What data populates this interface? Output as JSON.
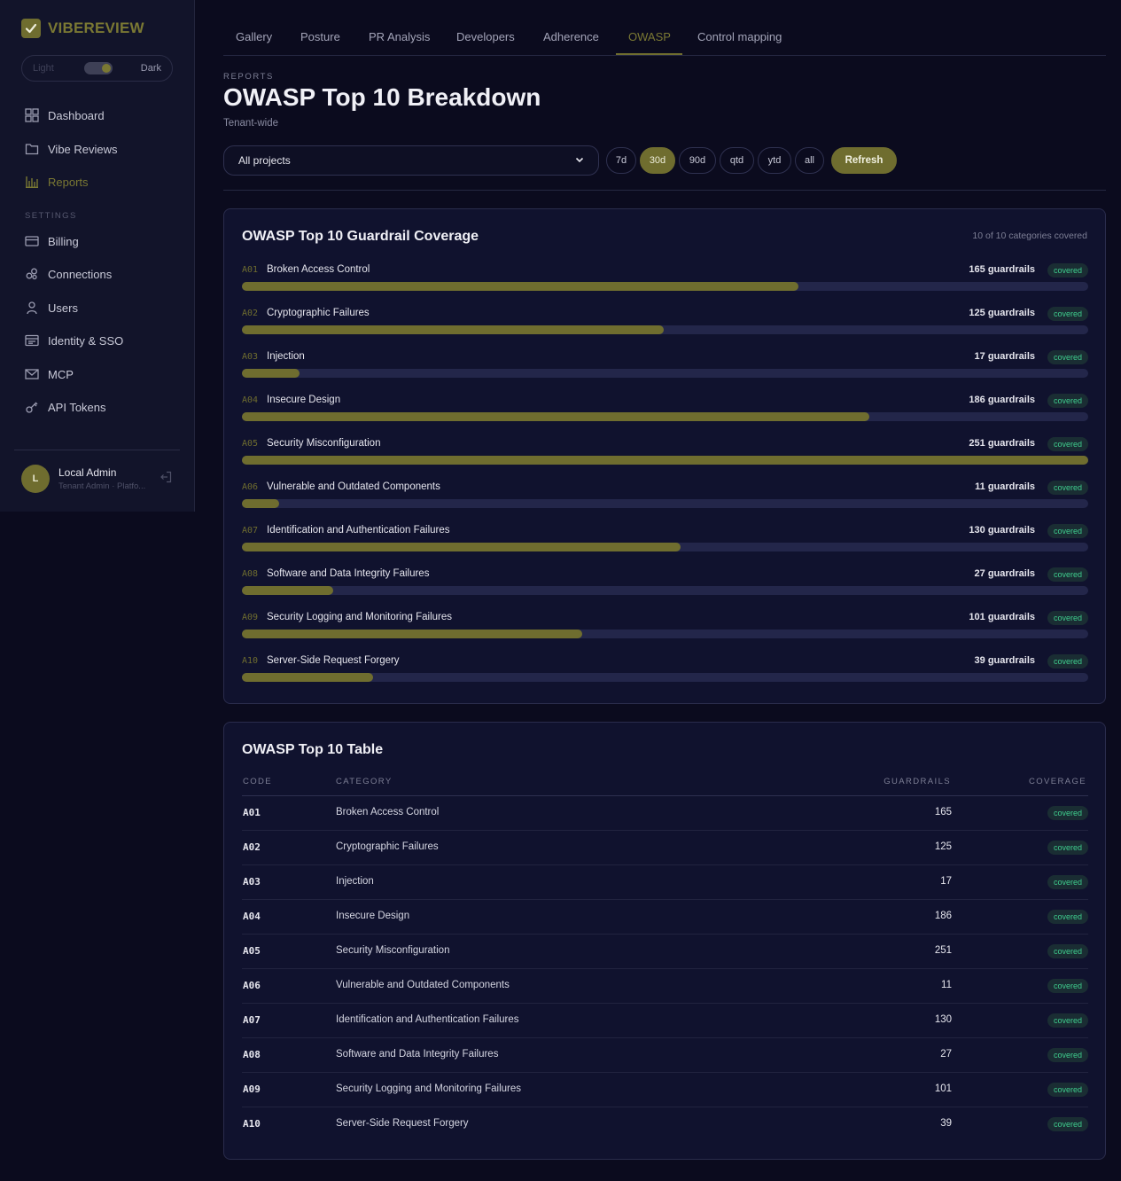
{
  "brand": {
    "name": "VIBEREVIEW"
  },
  "theme": {
    "light_label": "Light",
    "dark_label": "Dark"
  },
  "sidebar": {
    "items": [
      {
        "label": "Dashboard",
        "icon": "grid-icon"
      },
      {
        "label": "Vibe Reviews",
        "icon": "folder-icon"
      },
      {
        "label": "Reports",
        "icon": "bar-chart-icon",
        "active": true
      }
    ],
    "settings_label": "SETTINGS",
    "settings_items": [
      {
        "label": "Billing",
        "icon": "credit-card-icon"
      },
      {
        "label": "Connections",
        "icon": "connections-icon"
      },
      {
        "label": "Users",
        "icon": "user-icon"
      },
      {
        "label": "Identity & SSO",
        "icon": "id-card-icon"
      },
      {
        "label": "MCP",
        "icon": "mail-icon"
      },
      {
        "label": "API Tokens",
        "icon": "key-icon"
      }
    ]
  },
  "user": {
    "initial": "L",
    "name": "Local Admin",
    "subtitle": "Tenant Admin · Platfo..."
  },
  "tabs": [
    "Gallery",
    "Posture",
    "PR Analysis",
    "Developers",
    "Adherence",
    "OWASP",
    "Control mapping"
  ],
  "active_tab": "OWASP",
  "header": {
    "eyebrow": "REPORTS",
    "title": "OWASP Top 10 Breakdown",
    "subtitle": "Tenant-wide"
  },
  "filters": {
    "project": "All projects",
    "ranges": [
      "7d",
      "30d",
      "90d",
      "qtd",
      "ytd",
      "all"
    ],
    "active_range": "30d",
    "refresh_label": "Refresh"
  },
  "coverage": {
    "title": "OWASP Top 10 Guardrail Coverage",
    "meta": "10 of 10 categories covered",
    "count_suffix": "guardrails",
    "max": 251
  },
  "table": {
    "title": "OWASP Top 10 Table",
    "headers": {
      "code": "CODE",
      "category": "CATEGORY",
      "guardrails": "GUARDRAILS",
      "coverage": "COVERAGE"
    }
  },
  "categories": [
    {
      "code": "A01",
      "name": "Broken Access Control",
      "guardrails": 165,
      "status": "covered"
    },
    {
      "code": "A02",
      "name": "Cryptographic Failures",
      "guardrails": 125,
      "status": "covered"
    },
    {
      "code": "A03",
      "name": "Injection",
      "guardrails": 17,
      "status": "covered"
    },
    {
      "code": "A04",
      "name": "Insecure Design",
      "guardrails": 186,
      "status": "covered"
    },
    {
      "code": "A05",
      "name": "Security Misconfiguration",
      "guardrails": 251,
      "status": "covered"
    },
    {
      "code": "A06",
      "name": "Vulnerable and Outdated Components",
      "guardrails": 11,
      "status": "covered"
    },
    {
      "code": "A07",
      "name": "Identification and Authentication Failures",
      "guardrails": 130,
      "status": "covered"
    },
    {
      "code": "A08",
      "name": "Software and Data Integrity Failures",
      "guardrails": 27,
      "status": "covered"
    },
    {
      "code": "A09",
      "name": "Security Logging and Monitoring Failures",
      "guardrails": 101,
      "status": "covered"
    },
    {
      "code": "A10",
      "name": "Server-Side Request Forgery",
      "guardrails": 39,
      "status": "covered"
    }
  ],
  "colors": {
    "accent": "#6f6d2f",
    "badge_text": "#3fcf8e",
    "background": "#0b0b1e"
  }
}
